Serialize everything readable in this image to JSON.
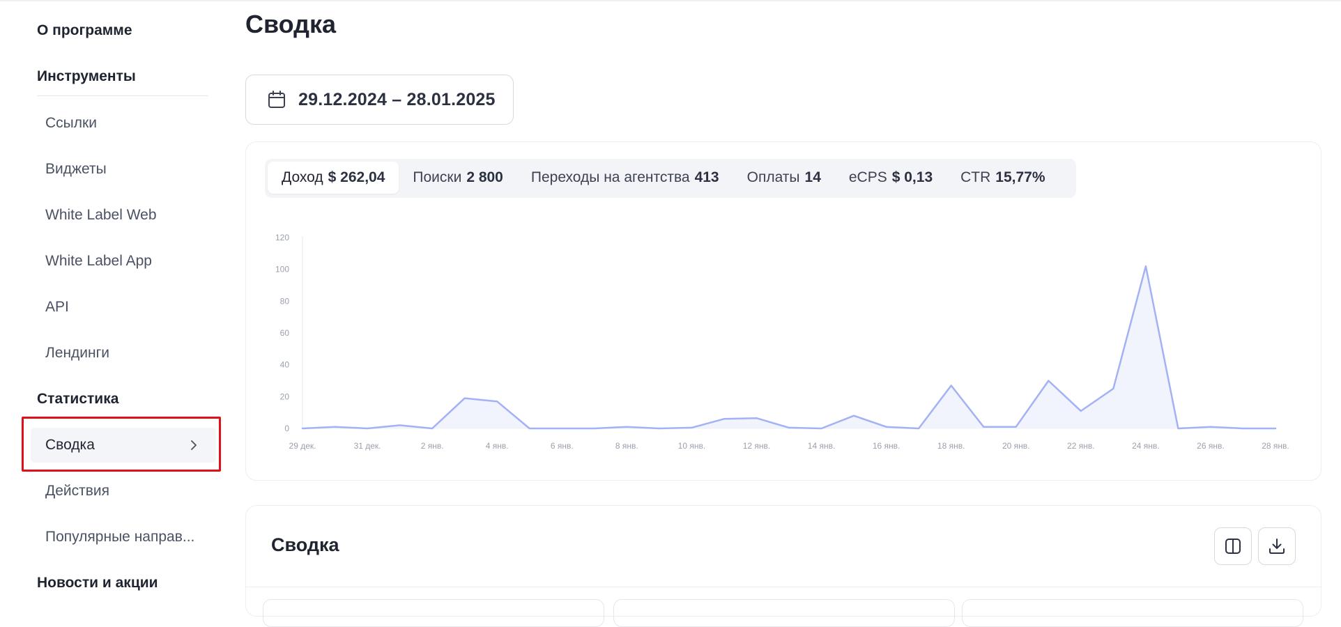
{
  "sidebar": {
    "sections": [
      {
        "label": "О программе"
      },
      {
        "label": "Инструменты"
      },
      {
        "label": "Статистика"
      },
      {
        "label": "Новости и акции"
      }
    ],
    "tools_items": [
      "Ссылки",
      "Виджеты",
      "White Label Web",
      "White Label App",
      "API",
      "Лендинги"
    ],
    "stats_items": [
      "Сводка",
      "Действия",
      "Популярные направ..."
    ]
  },
  "page": {
    "title": "Сводка",
    "date_range": "29.12.2024 – 28.01.2025"
  },
  "metrics": [
    {
      "label": "Доход",
      "value": "$ 262,04"
    },
    {
      "label": "Поиски",
      "value": "2 800"
    },
    {
      "label": "Переходы на агентства",
      "value": "413"
    },
    {
      "label": "Оплаты",
      "value": "14"
    },
    {
      "label": "eCPS",
      "value": "$ 0,13"
    },
    {
      "label": "CTR",
      "value": "15,77%"
    }
  ],
  "chart_data": {
    "type": "area",
    "x": [
      "29 дек.",
      "30 дек.",
      "31 дек.",
      "1 янв.",
      "2 янв.",
      "3 янв.",
      "4 янв.",
      "5 янв.",
      "6 янв.",
      "7 янв.",
      "8 янв.",
      "9 янв.",
      "10 янв.",
      "11 янв.",
      "12 янв.",
      "13 янв.",
      "14 янв.",
      "15 янв.",
      "16 янв.",
      "17 янв.",
      "18 янв.",
      "19 янв.",
      "20 янв.",
      "21 янв.",
      "22 янв.",
      "23 янв.",
      "24 янв.",
      "25 янв.",
      "26 янв.",
      "27 янв.",
      "28 янв."
    ],
    "x_ticks": [
      "29 дек.",
      "31 дек.",
      "2 янв.",
      "4 янв.",
      "6 янв.",
      "8 янв.",
      "10 янв.",
      "12 янв.",
      "14 янв.",
      "16 янв.",
      "18 янв.",
      "20 янв.",
      "22 янв.",
      "24 янв.",
      "26 янв.",
      "28 янв."
    ],
    "values": [
      0,
      1,
      0,
      2,
      0,
      19,
      17,
      0,
      0,
      0,
      1,
      0,
      0.5,
      6,
      6.5,
      0.5,
      0,
      8,
      1,
      0,
      27,
      1,
      1,
      30,
      11,
      25,
      102,
      0,
      1,
      0,
      0
    ],
    "y_ticks": [
      0,
      20,
      40,
      60,
      80,
      100,
      120
    ],
    "ylim": [
      0,
      120
    ],
    "color": "#a3b1f5",
    "fill_color": "#eef1fd",
    "grid": false
  },
  "summary": {
    "title": "Сводка"
  },
  "colors": {
    "highlight": "#e0101a",
    "accent_line": "#a3b1f5"
  }
}
